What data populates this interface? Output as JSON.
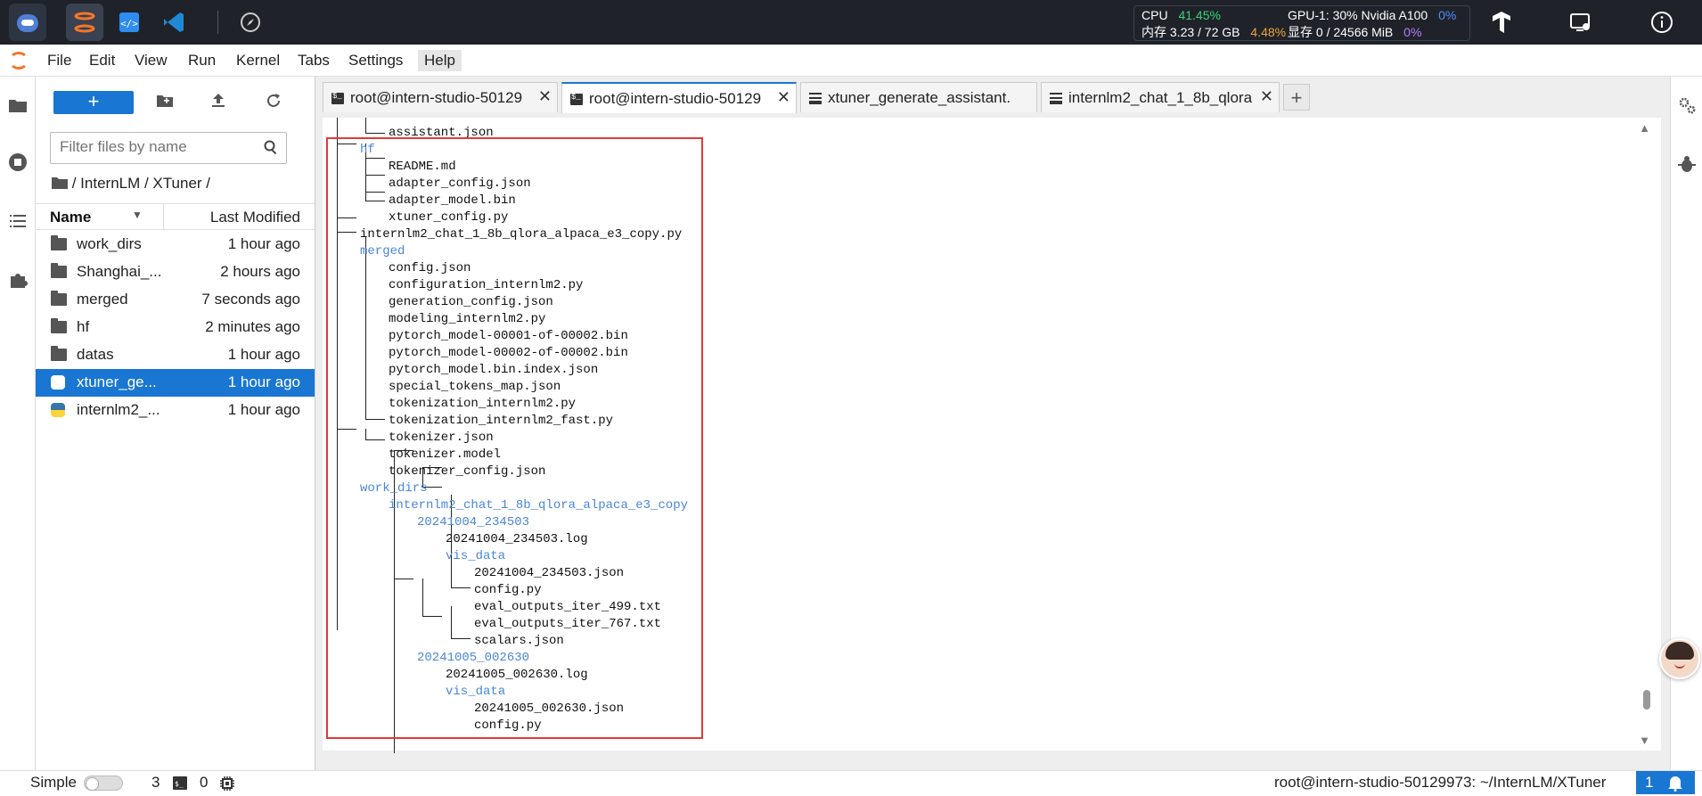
{
  "topbar": {
    "cpu_label": "CPU",
    "cpu_value": "41.45%",
    "mem_label": "内存 3.23 / 72 GB",
    "mem_value": "4.48%",
    "gpu_label": "GPU-1: 30% Nvidia A100",
    "gpu_value": "0%",
    "vram_label": "显存 0 / 24566 MiB",
    "vram_value": "0%"
  },
  "menubar": {
    "items": [
      "File",
      "Edit",
      "View",
      "Run",
      "Kernel",
      "Tabs",
      "Settings",
      "Help"
    ]
  },
  "filebrowser": {
    "new_label": "+",
    "filter_placeholder": "Filter files by name",
    "breadcrumb": "/ InternLM / XTuner /",
    "col_name": "Name",
    "col_modified": "Last Modified",
    "rows": [
      {
        "name": "work_dirs",
        "time": "1 hour ago"
      },
      {
        "name": "Shanghai_...",
        "time": "2 hours ago"
      },
      {
        "name": "merged",
        "time": "7 seconds ago"
      },
      {
        "name": "hf",
        "time": "2 minutes ago"
      },
      {
        "name": "datas",
        "time": "1 hour ago"
      },
      {
        "name": "xtuner_ge...",
        "time": "1 hour ago"
      },
      {
        "name": "internlm2_...",
        "time": "1 hour ago"
      }
    ]
  },
  "tabs": [
    {
      "label": "root@intern-studio-50129"
    },
    {
      "label": "root@intern-studio-50129"
    },
    {
      "label": "xtuner_generate_assistant."
    },
    {
      "label": "internlm2_chat_1_8b_qlora"
    }
  ],
  "tree": {
    "lines": [
      "assistant.json",
      "hf",
      "README.md",
      "adapter_config.json",
      "adapter_model.bin",
      "xtuner_config.py",
      "internlm2_chat_1_8b_qlora_alpaca_e3_copy.py",
      "merged",
      "config.json",
      "configuration_internlm2.py",
      "generation_config.json",
      "modeling_internlm2.py",
      "pytorch_model-00001-of-00002.bin",
      "pytorch_model-00002-of-00002.bin",
      "pytorch_model.bin.index.json",
      "special_tokens_map.json",
      "tokenization_internlm2.py",
      "tokenization_internlm2_fast.py",
      "tokenizer.json",
      "tokenizer.model",
      "tokenizer_config.json",
      "work_dirs",
      "internlm2_chat_1_8b_qlora_alpaca_e3_copy",
      "20241004_234503",
      "20241004_234503.log",
      "vis_data",
      "20241004_234503.json",
      "config.py",
      "eval_outputs_iter_499.txt",
      "eval_outputs_iter_767.txt",
      "scalars.json",
      "20241005_002630",
      "20241005_002630.log",
      "vis_data",
      "20241005_002630.json",
      "config.py"
    ]
  },
  "statusbar": {
    "mode": "Simple",
    "kernels": "3",
    "terminals": "0",
    "path": "root@intern-studio-50129973: ~/InternLM/XTuner",
    "notif": "1"
  }
}
